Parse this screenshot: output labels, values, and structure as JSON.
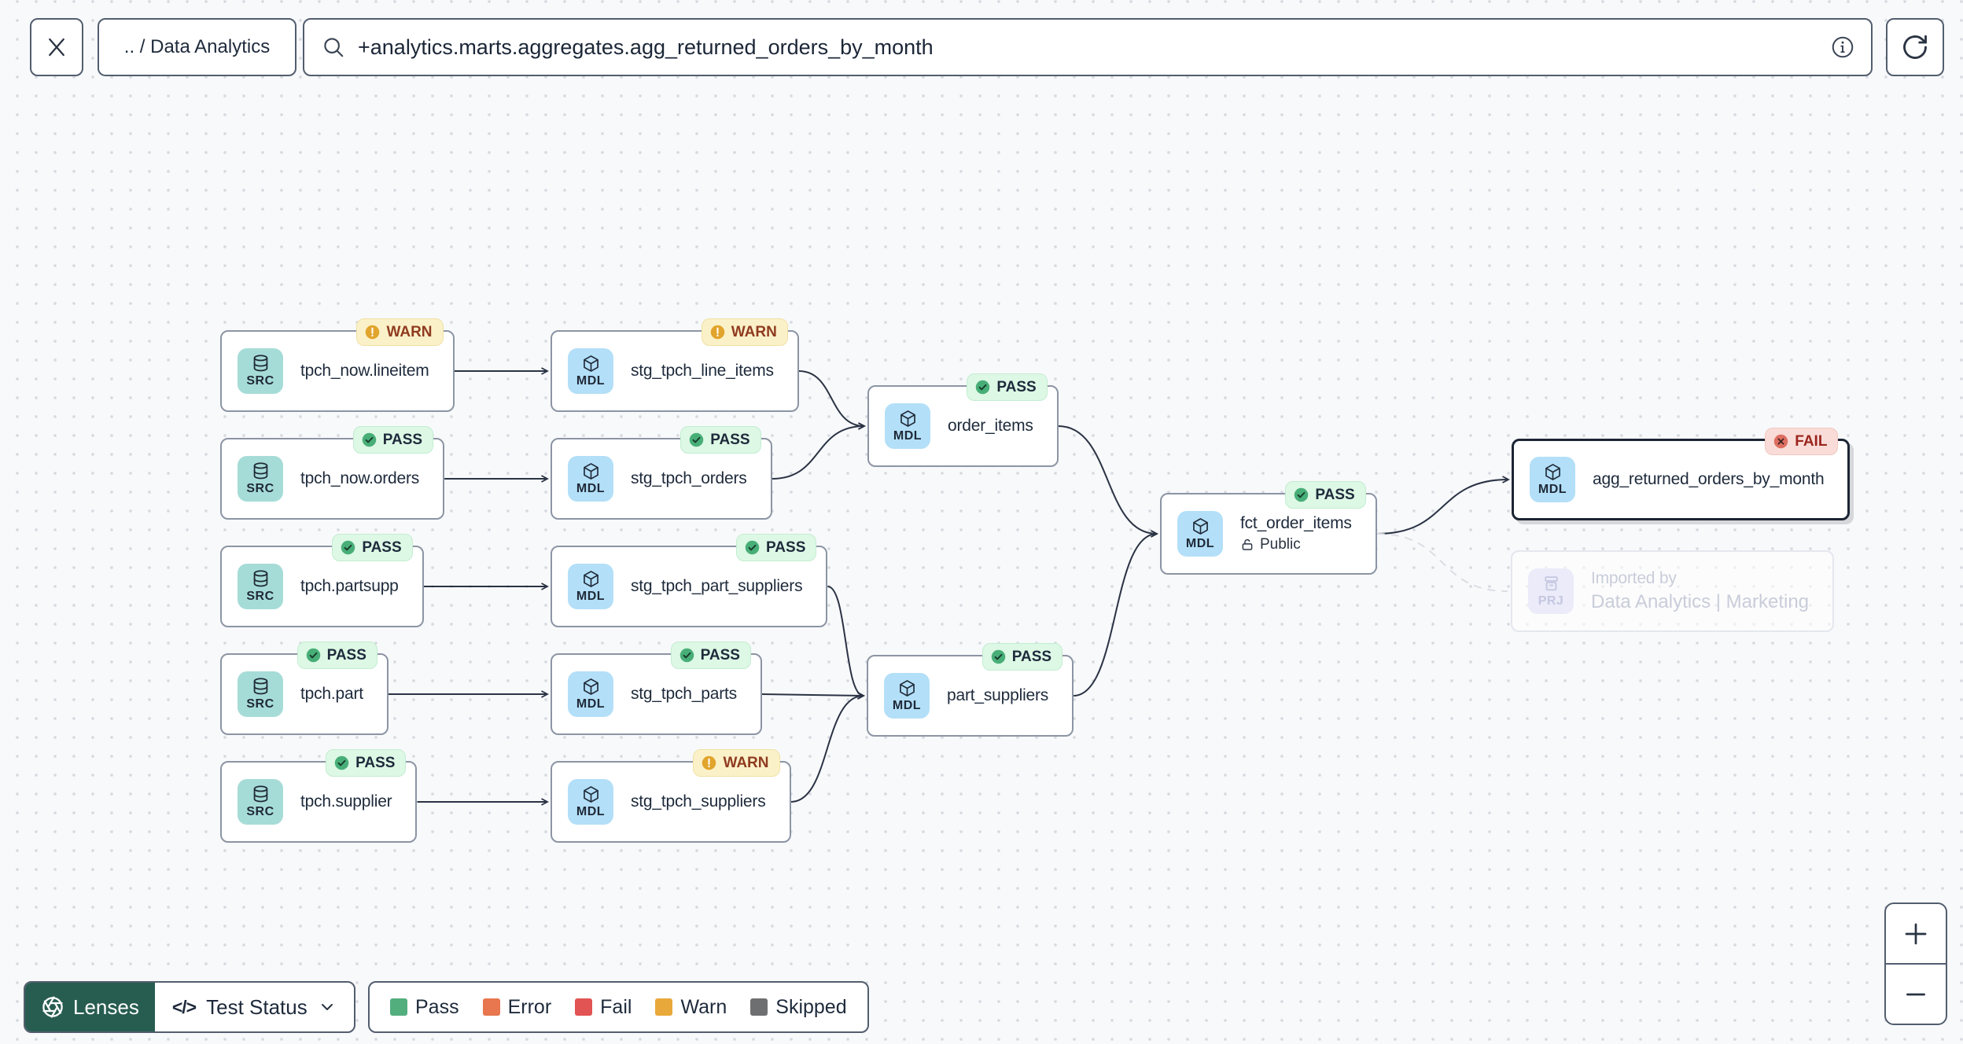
{
  "toolbar": {
    "breadcrumb": ".. / Data Analytics",
    "search_value": "+analytics.marts.aggregates.agg_returned_orders_by_month",
    "icons": {
      "close": "close-icon",
      "search": "search-icon",
      "info": "info-icon",
      "refresh": "refresh-icon"
    }
  },
  "graph": {
    "type_labels": {
      "SRC": "SRC",
      "MDL": "MDL",
      "PRJ": "PRJ"
    },
    "type_icons": {
      "SRC": "database-icon",
      "MDL": "cube-icon",
      "PRJ": "archive-icon"
    },
    "badges": {
      "PASS": {
        "label": "PASS",
        "icon": "check-circle-icon",
        "bg": "#DDF8E5",
        "icon_color": "#48AE78",
        "text_color": "#1E2A3B"
      },
      "WARN": {
        "label": "WARN",
        "icon": "exclamation-circle-icon",
        "bg": "#FBF1C9",
        "icon_color": "#E1A42C",
        "text_color": "#8F3B1F"
      },
      "FAIL": {
        "label": "FAIL",
        "icon": "x-circle-icon",
        "bg": "#F9DCD8",
        "icon_color": "#DE6E61",
        "text_color": "#9B241E"
      }
    },
    "nodes": [
      {
        "id": "tpch_now_lineitem",
        "type": "SRC",
        "label": "tpch_now.lineitem",
        "badge": "WARN"
      },
      {
        "id": "tpch_now_orders",
        "type": "SRC",
        "label": "tpch_now.orders",
        "badge": "PASS"
      },
      {
        "id": "tpch_partsupp",
        "type": "SRC",
        "label": "tpch.partsupp",
        "badge": "PASS"
      },
      {
        "id": "tpch_part",
        "type": "SRC",
        "label": "tpch.part",
        "badge": "PASS"
      },
      {
        "id": "tpch_supplier",
        "type": "SRC",
        "label": "tpch.supplier",
        "badge": "PASS"
      },
      {
        "id": "stg_tpch_line_items",
        "type": "MDL",
        "label": "stg_tpch_line_items",
        "badge": "WARN"
      },
      {
        "id": "stg_tpch_orders",
        "type": "MDL",
        "label": "stg_tpch_orders",
        "badge": "PASS"
      },
      {
        "id": "stg_tpch_part_suppliers",
        "type": "MDL",
        "label": "stg_tpch_part_suppliers",
        "badge": "PASS"
      },
      {
        "id": "stg_tpch_parts",
        "type": "MDL",
        "label": "stg_tpch_parts",
        "badge": "PASS"
      },
      {
        "id": "stg_tpch_suppliers",
        "type": "MDL",
        "label": "stg_tpch_suppliers",
        "badge": "WARN"
      },
      {
        "id": "order_items",
        "type": "MDL",
        "label": "order_items",
        "badge": "PASS"
      },
      {
        "id": "part_suppliers",
        "type": "MDL",
        "label": "part_suppliers",
        "badge": "PASS"
      },
      {
        "id": "fct_order_items",
        "type": "MDL",
        "label": "fct_order_items",
        "badge": "PASS",
        "sublabel": "Public",
        "sublabel_lock": true
      },
      {
        "id": "agg_returned_orders_by_month",
        "type": "MDL",
        "label": "agg_returned_orders_by_month",
        "badge": "FAIL",
        "selected": true
      },
      {
        "id": "imported_by_project",
        "type": "PRJ",
        "label": "Imported by",
        "sublabel": "Data Analytics | Marketing",
        "faded": true
      }
    ],
    "edges": [
      {
        "from": "tpch_now_lineitem",
        "to": "stg_tpch_line_items",
        "style": "solid"
      },
      {
        "from": "tpch_now_orders",
        "to": "stg_tpch_orders",
        "style": "solid"
      },
      {
        "from": "tpch_partsupp",
        "to": "stg_tpch_part_suppliers",
        "style": "solid"
      },
      {
        "from": "tpch_part",
        "to": "stg_tpch_parts",
        "style": "solid"
      },
      {
        "from": "tpch_supplier",
        "to": "stg_tpch_suppliers",
        "style": "solid"
      },
      {
        "from": "stg_tpch_line_items",
        "to": "order_items",
        "style": "solid"
      },
      {
        "from": "stg_tpch_orders",
        "to": "order_items",
        "style": "solid"
      },
      {
        "from": "stg_tpch_part_suppliers",
        "to": "part_suppliers",
        "style": "solid"
      },
      {
        "from": "stg_tpch_parts",
        "to": "part_suppliers",
        "style": "solid"
      },
      {
        "from": "stg_tpch_suppliers",
        "to": "part_suppliers",
        "style": "solid"
      },
      {
        "from": "order_items",
        "to": "fct_order_items",
        "style": "solid"
      },
      {
        "from": "part_suppliers",
        "to": "fct_order_items",
        "style": "solid"
      },
      {
        "from": "fct_order_items",
        "to": "agg_returned_orders_by_month",
        "style": "solid"
      },
      {
        "from": "fct_order_items",
        "to": "imported_by_project",
        "style": "dashed"
      }
    ]
  },
  "footer": {
    "lenses_label": "Lenses",
    "lenses_icon": "aperture-icon",
    "lens_selector_icon": "code-icon",
    "lens_selector_glyph": "</>",
    "lens_selector_label": "Test Status",
    "legend": [
      {
        "label": "Pass",
        "color": "#53AE7E"
      },
      {
        "label": "Error",
        "color": "#E8764E"
      },
      {
        "label": "Fail",
        "color": "#E25353"
      },
      {
        "label": "Warn",
        "color": "#E9A83A"
      },
      {
        "label": "Skipped",
        "color": "#6E6F71"
      }
    ]
  },
  "zoom_controls": {
    "zoom_in": "+",
    "zoom_out": "−"
  },
  "colors": {
    "lenses_green": "#275D50",
    "node_border": "#8C95A4",
    "selected_border": "#1C2534",
    "edge": "#2A3344",
    "src_chip": "#A6DCD7",
    "mdl_chip": "#B3DFF8",
    "prj_chip": "#EBEBF9"
  }
}
